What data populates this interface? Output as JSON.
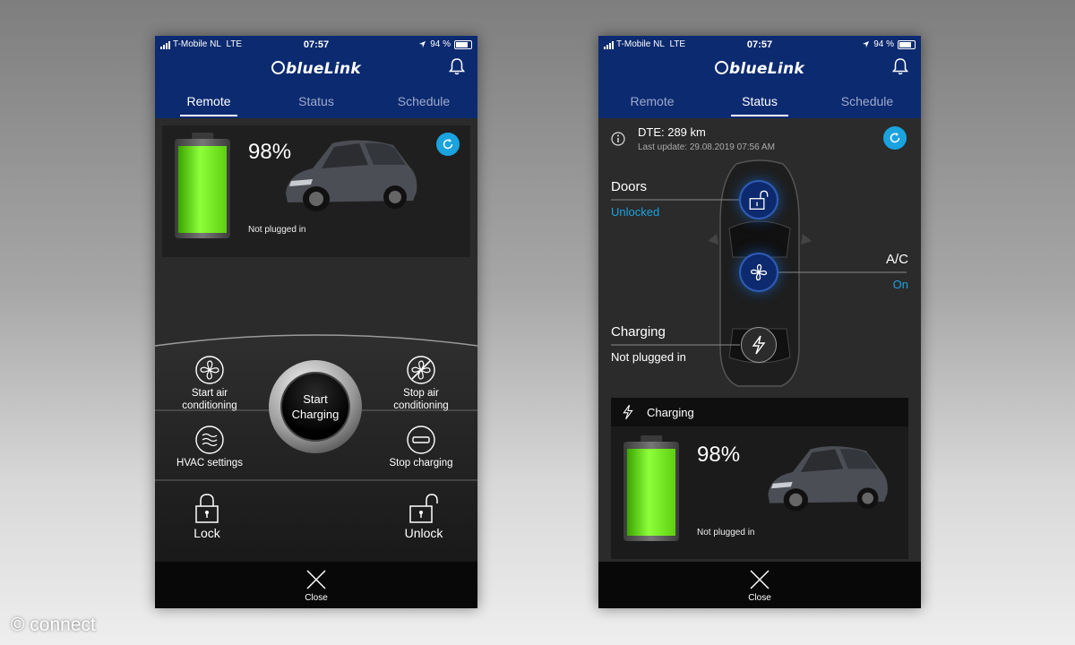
{
  "status_bar": {
    "carrier": "T-Mobile NL",
    "network": "LTE",
    "time": "07:57",
    "battery": "94 %"
  },
  "app": {
    "logo": "blueLink"
  },
  "tabs": [
    "Remote",
    "Status",
    "Schedule"
  ],
  "remote": {
    "battery_pct": "98%",
    "battery_level": 0.98,
    "plug_status": "Not plugged in",
    "controls": {
      "start_ac": "Start air conditioning",
      "stop_ac": "Stop air conditioning",
      "hvac": "HVAC settings",
      "stop_charging": "Stop charging",
      "start_charging": [
        "Start",
        "Charging"
      ],
      "lock": "Lock",
      "unlock": "Unlock"
    },
    "close": "Close"
  },
  "status": {
    "dte": "DTE: 289 km",
    "last_update": "Last update: 29.08.2019 07:56 AM",
    "doors_label": "Doors",
    "doors_value": "Unlocked",
    "ac_label": "A/C",
    "ac_value": "On",
    "charging_label": "Charging",
    "charging_value": "Not plugged in",
    "charging_card_title": "Charging",
    "battery_pct": "98%",
    "battery_level": 0.98,
    "plug_status": "Not plugged in",
    "close": "Close"
  },
  "colors": {
    "header_blue": "#0c2a70",
    "accent_cyan": "#1aa3df",
    "battery_green": "#8dff3a"
  },
  "watermark": "© connect"
}
